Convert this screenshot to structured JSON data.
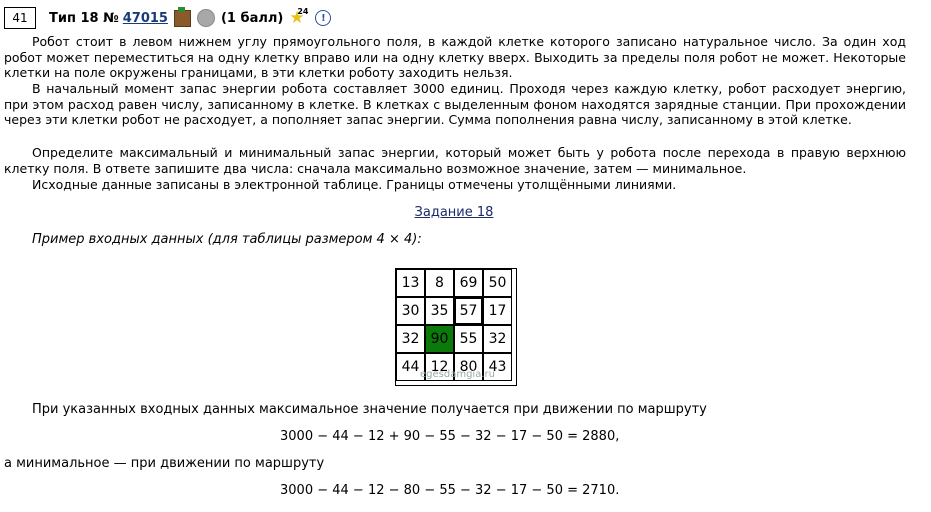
{
  "header": {
    "number": "41",
    "type_label": "Тип 18 №",
    "task_id": "47015",
    "points": "(1 балл)",
    "star_count": "24",
    "info_symbol": "!"
  },
  "paragraphs": [
    "Робот стоит в левом нижнем углу прямоугольного поля, в каждой клетке которого записано натуральное число. За один ход робот может переместиться на одну клетку вправо или на одну клетку вверх. Выходить за пределы поля робот не может. Некоторые клетки на поле окружены границами, в эти клетки роботу заходить нельзя.",
    "В начальный момент запас энергии робота составляет 3000 единиц. Проходя через каждую клетку, робот расходует энергию, при этом расход равен числу, записанному в клетке. В клетках с выделенным фоном находятся зарядные станции. При прохождении через эти клетки робот не расходует, а пополняет запас энергии. Сумма пополнения равна числу, записанному в этой клетке.",
    "Определите максимальный и минимальный запас энергии, который может быть у робота после перехода в правую верхнюю клетку поля. В ответе запишите два числа: сначала максимально возможное значение, затем — минимальное.",
    "Исходные данные записаны в электронной таблице. Границы отмечены утолщёнными линиями."
  ],
  "link_text": "Задание 18",
  "example_label": "Пример входных данных (для таблицы размером 4 × 4):",
  "grid": [
    [
      "13",
      "8",
      "69",
      "50"
    ],
    [
      "30",
      "35",
      "57",
      "17"
    ],
    [
      "32",
      "90",
      "55",
      "32"
    ],
    [
      "44",
      "12",
      "80",
      "43"
    ]
  ],
  "watermark": "egesdamgia.ru",
  "solution": {
    "max_intro": "При указанных входных данных максимальное значение получается при движении по маршруту",
    "max_formula": "3000 − 44 − 12 + 90 − 55 − 32 − 17 − 50 = 2880,",
    "min_intro": "а минимальное — при движении по маршруту",
    "min_formula": "3000 − 44 − 12 − 80 − 55 − 32 − 17 − 50 = 2710."
  }
}
